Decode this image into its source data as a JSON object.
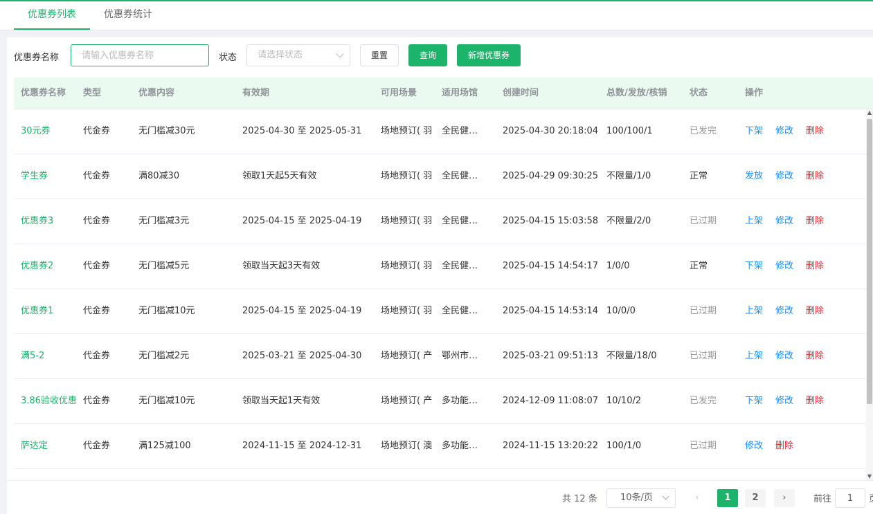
{
  "tabs": [
    {
      "label": "优惠券列表",
      "active": true
    },
    {
      "label": "优惠券统计",
      "active": false
    }
  ],
  "filter": {
    "name_label": "优惠券名称",
    "name_placeholder": "请输入优惠券名称",
    "status_label": "状态",
    "status_placeholder": "请选择状态",
    "reset_label": "重置",
    "search_label": "查询",
    "add_label": "新增优惠券"
  },
  "table": {
    "headers": [
      "优惠券名称",
      "类型",
      "优惠内容",
      "有效期",
      "可用场景",
      "适用场馆",
      "创建时间",
      "总数/发放/核销",
      "状态",
      "操作"
    ],
    "rows": [
      {
        "name": "30元券",
        "type": "代金券",
        "content": "无门槛减30元",
        "validity": "2025-04-30 至 2025-05-31",
        "scene": "场地预订( 羽",
        "venue": "全民健…",
        "created": "2025-04-30 20:18:04",
        "counts": "100/100/1",
        "status": "已发完",
        "actions": [
          "下架",
          "修改",
          "删除"
        ]
      },
      {
        "name": "学生券",
        "type": "代金券",
        "content": "满80减30",
        "validity": "领取1天起5天有效",
        "scene": "场地预订( 羽",
        "venue": "全民健…",
        "created": "2025-04-29 09:30:25",
        "counts": "不限量/1/0",
        "status": "正常",
        "actions": [
          "发放",
          "修改",
          "删除"
        ]
      },
      {
        "name": "优惠券3",
        "type": "代金券",
        "content": "无门槛减3元",
        "validity": "2025-04-15 至 2025-04-19",
        "scene": "场地预订( 羽",
        "venue": "全民健…",
        "created": "2025-04-15 15:03:58",
        "counts": "不限量/2/0",
        "status": "已过期",
        "actions": [
          "上架",
          "修改",
          "删除"
        ]
      },
      {
        "name": "优惠券2",
        "type": "代金券",
        "content": "无门槛减5元",
        "validity": "领取当天起3天有效",
        "scene": "场地预订( 羽",
        "venue": "全民健…",
        "created": "2025-04-15 14:54:17",
        "counts": "1/0/0",
        "status": "正常",
        "actions": [
          "下架",
          "修改",
          "删除"
        ]
      },
      {
        "name": "优惠券1",
        "type": "代金券",
        "content": "无门槛减10元",
        "validity": "2025-04-15 至 2025-04-19",
        "scene": "场地预订( 羽",
        "venue": "全民健…",
        "created": "2025-04-15 14:53:14",
        "counts": "10/0/0",
        "status": "已过期",
        "actions": [
          "上架",
          "修改",
          "删除"
        ]
      },
      {
        "name": "满5-2",
        "type": "代金券",
        "content": "无门槛减2元",
        "validity": "2025-03-21 至 2025-04-30",
        "scene": "场地预订( 产",
        "venue": "鄂州市…",
        "created": "2025-03-21 09:51:13",
        "counts": "不限量/18/0",
        "status": "已过期",
        "actions": [
          "上架",
          "修改",
          "删除"
        ]
      },
      {
        "name": "3.86验收优惠",
        "type": "代金券",
        "content": "无门槛减10元",
        "validity": "领取当天起1天有效",
        "scene": "场地预订( 产",
        "venue": "多功能…",
        "created": "2024-12-09 11:08:07",
        "counts": "10/10/2",
        "status": "已发完",
        "actions": [
          "下架",
          "修改",
          "删除"
        ]
      },
      {
        "name": "萨达定",
        "type": "代金券",
        "content": "满125减100",
        "validity": "2024-11-15 至 2024-12-31",
        "scene": "场地预订( 澳",
        "venue": "多功能…",
        "created": "2024-11-15 13:20:22",
        "counts": "100/1/0",
        "status": "已过期",
        "actions": [
          "修改",
          "删除"
        ]
      }
    ]
  },
  "pager": {
    "total": "共 12 条",
    "page_size": "10条/页",
    "prev": "‹",
    "next": "›",
    "pages": [
      "1",
      "2"
    ],
    "current": "1",
    "goto_label": "前往",
    "goto_value": "1",
    "page_suffix": "页"
  },
  "colors": {
    "accent": "#1cb46a",
    "link": "#1890ff",
    "danger": "#f5222d",
    "muted": "#999999"
  }
}
